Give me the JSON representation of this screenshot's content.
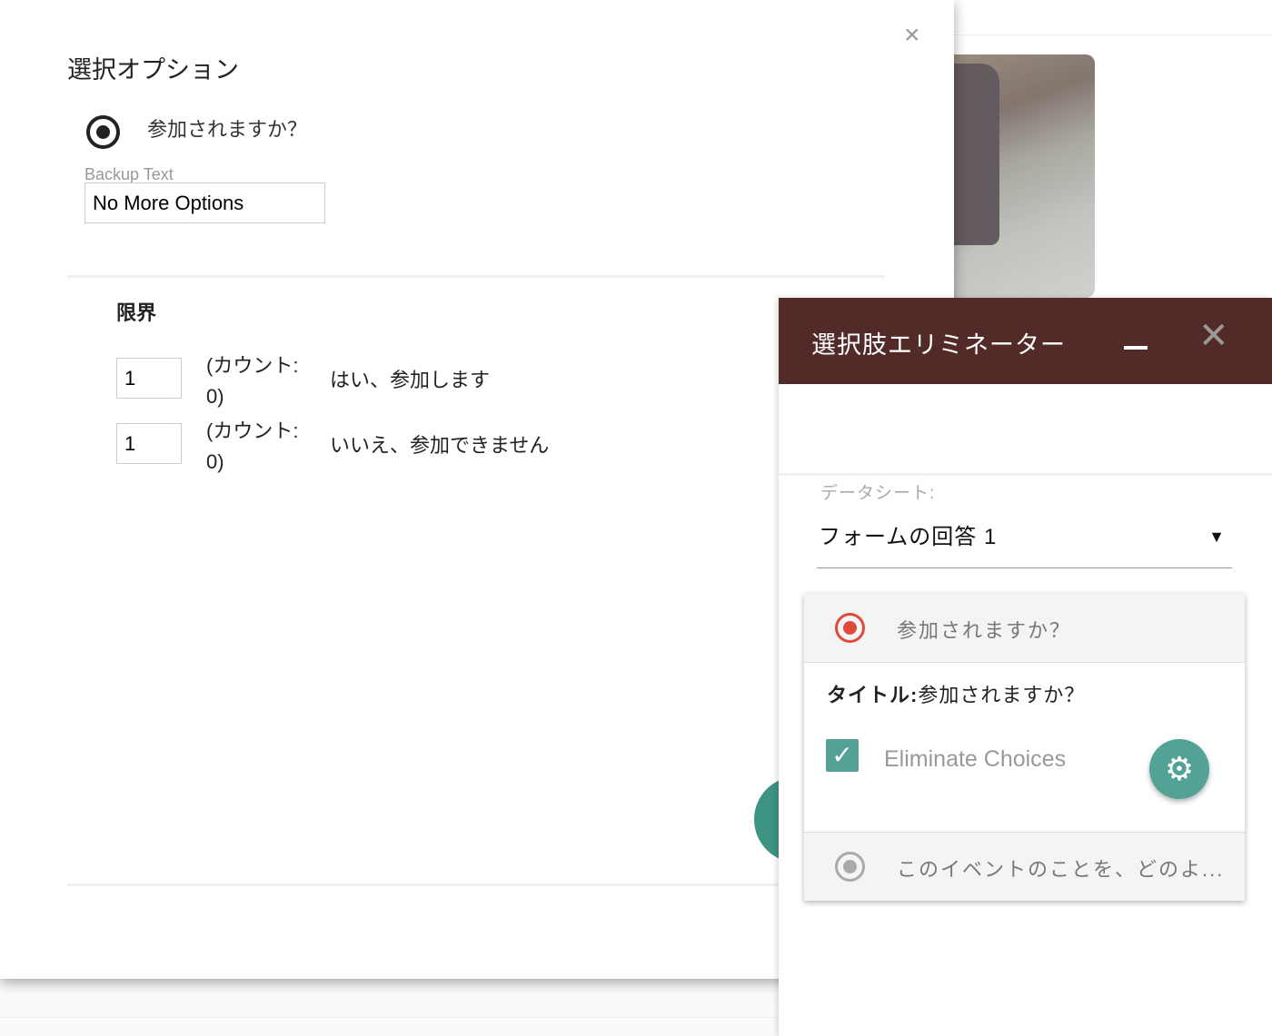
{
  "dialog": {
    "title": "選択オプション",
    "close_icon": "×",
    "question": "参加されますか？",
    "backup_label": "Backup Text",
    "backup_value": "No More Options",
    "limits_title": "限界",
    "limits": [
      {
        "value": "1",
        "count": "(カウント: 0)",
        "choice": "はい、参加します"
      },
      {
        "value": "1",
        "count": "(カウント: 0)",
        "choice": "いいえ、参加できません"
      }
    ]
  },
  "panel": {
    "title": "選択肢エリミネーター",
    "close_icon": "✕",
    "sheet_label": "データシート:",
    "sheet_value": "フォームの回答 1",
    "dropdown_arrow": "▼",
    "questions": [
      {
        "text": "参加されますか？",
        "selected": true
      },
      {
        "text": "このイベントのことを、どのよ..."
      }
    ],
    "detail_title_label": "タイトル:",
    "detail_title_value": "参加されますか？",
    "eliminate_label": "Eliminate Choices",
    "eliminate_checked": true,
    "check_icon": "✓",
    "gear_icon": "⚙"
  },
  "colors": {
    "header": "#522b29",
    "accent": "#52a296",
    "selected_radio": "#e04a3a"
  }
}
